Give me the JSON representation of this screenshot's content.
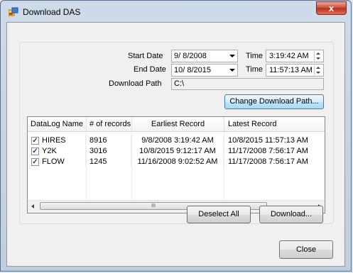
{
  "window": {
    "title": "Download DAS",
    "close_glyph": "x"
  },
  "dates": {
    "start_label": "Start Date",
    "start_value": "9/  8/2008",
    "end_label": "End Date",
    "end_value": "10/  8/2015",
    "time_label": "Time",
    "start_time": "3:19:42 AM",
    "end_time": "11:57:13 AM",
    "path_label": "Download Path",
    "path_value": "C:\\"
  },
  "buttons": {
    "change_path": "Change Download Path...",
    "deselect_all": "Deselect All",
    "download": "Download...",
    "close": "Close"
  },
  "table": {
    "headers": [
      "DataLog Name",
      "# of records",
      "Earliest Record",
      "Latest Record"
    ],
    "rows": [
      {
        "checked": true,
        "name": "HIRES",
        "records": "8916",
        "earliest": "9/8/2008 3:19:42 AM",
        "latest": "10/8/2015 11:57:13 AM"
      },
      {
        "checked": true,
        "name": "Y2K",
        "records": "3016",
        "earliest": "10/8/2015 9:12:17 AM",
        "latest": "11/17/2008 7:56:17 AM"
      },
      {
        "checked": true,
        "name": "FLOW",
        "records": "1245",
        "earliest": "11/16/2008 9:02:52 AM",
        "latest": "11/17/2008 7:56:17 AM"
      }
    ],
    "scroll_grip": "III"
  },
  "icons": {
    "app": "app-window-icon",
    "check": "✓"
  }
}
